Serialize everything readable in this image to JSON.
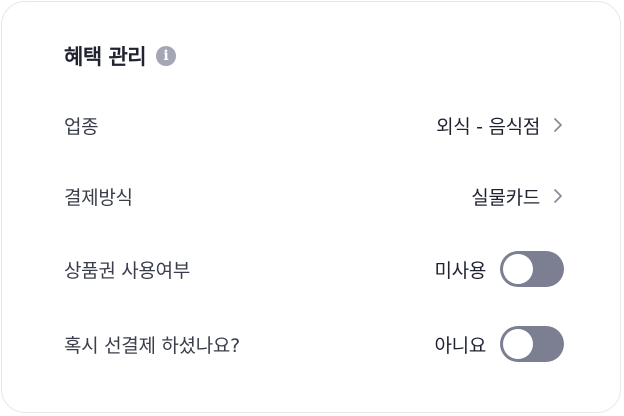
{
  "card": {
    "title": "혜택 관리",
    "info_icon": "info-icon"
  },
  "rows": [
    {
      "label": "업종",
      "value": "외식 - 음식점",
      "control": "chevron-right-icon"
    },
    {
      "label": "결제방식",
      "value": "실물카드",
      "control": "chevron-right-icon"
    },
    {
      "label": "상품권 사용여부",
      "value": "미사용",
      "control": "toggle",
      "toggle_on": false
    },
    {
      "label": "혹시 선결제 하셨나요?",
      "value": "아니요",
      "control": "toggle",
      "toggle_on": false
    }
  ],
  "colors": {
    "toggle_off": "#7c7f92",
    "info_icon": "#a3a6b4",
    "chevron": "#8a8d9a"
  }
}
